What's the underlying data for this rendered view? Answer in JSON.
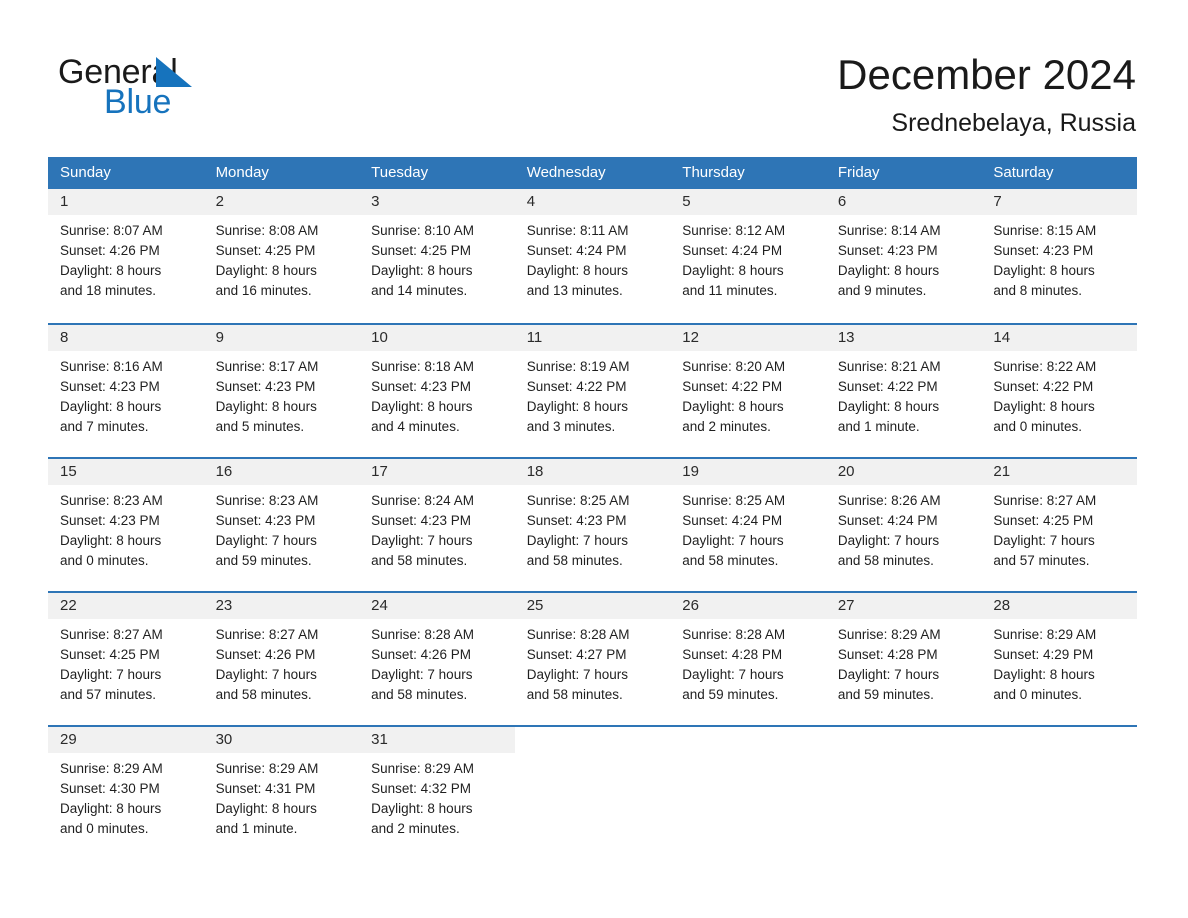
{
  "brand": {
    "name_part1": "General",
    "name_part2": "Blue",
    "accent_color": "#1673bd"
  },
  "header": {
    "month_title": "December 2024",
    "location": "Srednebelaya, Russia"
  },
  "calendar": {
    "header_color": "#2e75b6",
    "band_color": "#f1f1f1",
    "weekdays": [
      "Sunday",
      "Monday",
      "Tuesday",
      "Wednesday",
      "Thursday",
      "Friday",
      "Saturday"
    ],
    "weeks": [
      [
        {
          "day": "1",
          "sunrise": "Sunrise: 8:07 AM",
          "sunset": "Sunset: 4:26 PM",
          "daylight_line1": "Daylight: 8 hours",
          "daylight_line2": "and 18 minutes."
        },
        {
          "day": "2",
          "sunrise": "Sunrise: 8:08 AM",
          "sunset": "Sunset: 4:25 PM",
          "daylight_line1": "Daylight: 8 hours",
          "daylight_line2": "and 16 minutes."
        },
        {
          "day": "3",
          "sunrise": "Sunrise: 8:10 AM",
          "sunset": "Sunset: 4:25 PM",
          "daylight_line1": "Daylight: 8 hours",
          "daylight_line2": "and 14 minutes."
        },
        {
          "day": "4",
          "sunrise": "Sunrise: 8:11 AM",
          "sunset": "Sunset: 4:24 PM",
          "daylight_line1": "Daylight: 8 hours",
          "daylight_line2": "and 13 minutes."
        },
        {
          "day": "5",
          "sunrise": "Sunrise: 8:12 AM",
          "sunset": "Sunset: 4:24 PM",
          "daylight_line1": "Daylight: 8 hours",
          "daylight_line2": "and 11 minutes."
        },
        {
          "day": "6",
          "sunrise": "Sunrise: 8:14 AM",
          "sunset": "Sunset: 4:23 PM",
          "daylight_line1": "Daylight: 8 hours",
          "daylight_line2": "and 9 minutes."
        },
        {
          "day": "7",
          "sunrise": "Sunrise: 8:15 AM",
          "sunset": "Sunset: 4:23 PM",
          "daylight_line1": "Daylight: 8 hours",
          "daylight_line2": "and 8 minutes."
        }
      ],
      [
        {
          "day": "8",
          "sunrise": "Sunrise: 8:16 AM",
          "sunset": "Sunset: 4:23 PM",
          "daylight_line1": "Daylight: 8 hours",
          "daylight_line2": "and 7 minutes."
        },
        {
          "day": "9",
          "sunrise": "Sunrise: 8:17 AM",
          "sunset": "Sunset: 4:23 PM",
          "daylight_line1": "Daylight: 8 hours",
          "daylight_line2": "and 5 minutes."
        },
        {
          "day": "10",
          "sunrise": "Sunrise: 8:18 AM",
          "sunset": "Sunset: 4:23 PM",
          "daylight_line1": "Daylight: 8 hours",
          "daylight_line2": "and 4 minutes."
        },
        {
          "day": "11",
          "sunrise": "Sunrise: 8:19 AM",
          "sunset": "Sunset: 4:22 PM",
          "daylight_line1": "Daylight: 8 hours",
          "daylight_line2": "and 3 minutes."
        },
        {
          "day": "12",
          "sunrise": "Sunrise: 8:20 AM",
          "sunset": "Sunset: 4:22 PM",
          "daylight_line1": "Daylight: 8 hours",
          "daylight_line2": "and 2 minutes."
        },
        {
          "day": "13",
          "sunrise": "Sunrise: 8:21 AM",
          "sunset": "Sunset: 4:22 PM",
          "daylight_line1": "Daylight: 8 hours",
          "daylight_line2": "and 1 minute."
        },
        {
          "day": "14",
          "sunrise": "Sunrise: 8:22 AM",
          "sunset": "Sunset: 4:22 PM",
          "daylight_line1": "Daylight: 8 hours",
          "daylight_line2": "and 0 minutes."
        }
      ],
      [
        {
          "day": "15",
          "sunrise": "Sunrise: 8:23 AM",
          "sunset": "Sunset: 4:23 PM",
          "daylight_line1": "Daylight: 8 hours",
          "daylight_line2": "and 0 minutes."
        },
        {
          "day": "16",
          "sunrise": "Sunrise: 8:23 AM",
          "sunset": "Sunset: 4:23 PM",
          "daylight_line1": "Daylight: 7 hours",
          "daylight_line2": "and 59 minutes."
        },
        {
          "day": "17",
          "sunrise": "Sunrise: 8:24 AM",
          "sunset": "Sunset: 4:23 PM",
          "daylight_line1": "Daylight: 7 hours",
          "daylight_line2": "and 58 minutes."
        },
        {
          "day": "18",
          "sunrise": "Sunrise: 8:25 AM",
          "sunset": "Sunset: 4:23 PM",
          "daylight_line1": "Daylight: 7 hours",
          "daylight_line2": "and 58 minutes."
        },
        {
          "day": "19",
          "sunrise": "Sunrise: 8:25 AM",
          "sunset": "Sunset: 4:24 PM",
          "daylight_line1": "Daylight: 7 hours",
          "daylight_line2": "and 58 minutes."
        },
        {
          "day": "20",
          "sunrise": "Sunrise: 8:26 AM",
          "sunset": "Sunset: 4:24 PM",
          "daylight_line1": "Daylight: 7 hours",
          "daylight_line2": "and 58 minutes."
        },
        {
          "day": "21",
          "sunrise": "Sunrise: 8:27 AM",
          "sunset": "Sunset: 4:25 PM",
          "daylight_line1": "Daylight: 7 hours",
          "daylight_line2": "and 57 minutes."
        }
      ],
      [
        {
          "day": "22",
          "sunrise": "Sunrise: 8:27 AM",
          "sunset": "Sunset: 4:25 PM",
          "daylight_line1": "Daylight: 7 hours",
          "daylight_line2": "and 57 minutes."
        },
        {
          "day": "23",
          "sunrise": "Sunrise: 8:27 AM",
          "sunset": "Sunset: 4:26 PM",
          "daylight_line1": "Daylight: 7 hours",
          "daylight_line2": "and 58 minutes."
        },
        {
          "day": "24",
          "sunrise": "Sunrise: 8:28 AM",
          "sunset": "Sunset: 4:26 PM",
          "daylight_line1": "Daylight: 7 hours",
          "daylight_line2": "and 58 minutes."
        },
        {
          "day": "25",
          "sunrise": "Sunrise: 8:28 AM",
          "sunset": "Sunset: 4:27 PM",
          "daylight_line1": "Daylight: 7 hours",
          "daylight_line2": "and 58 minutes."
        },
        {
          "day": "26",
          "sunrise": "Sunrise: 8:28 AM",
          "sunset": "Sunset: 4:28 PM",
          "daylight_line1": "Daylight: 7 hours",
          "daylight_line2": "and 59 minutes."
        },
        {
          "day": "27",
          "sunrise": "Sunrise: 8:29 AM",
          "sunset": "Sunset: 4:28 PM",
          "daylight_line1": "Daylight: 7 hours",
          "daylight_line2": "and 59 minutes."
        },
        {
          "day": "28",
          "sunrise": "Sunrise: 8:29 AM",
          "sunset": "Sunset: 4:29 PM",
          "daylight_line1": "Daylight: 8 hours",
          "daylight_line2": "and 0 minutes."
        }
      ],
      [
        {
          "day": "29",
          "sunrise": "Sunrise: 8:29 AM",
          "sunset": "Sunset: 4:30 PM",
          "daylight_line1": "Daylight: 8 hours",
          "daylight_line2": "and 0 minutes."
        },
        {
          "day": "30",
          "sunrise": "Sunrise: 8:29 AM",
          "sunset": "Sunset: 4:31 PM",
          "daylight_line1": "Daylight: 8 hours",
          "daylight_line2": "and 1 minute."
        },
        {
          "day": "31",
          "sunrise": "Sunrise: 8:29 AM",
          "sunset": "Sunset: 4:32 PM",
          "daylight_line1": "Daylight: 8 hours",
          "daylight_line2": "and 2 minutes."
        },
        {
          "day": "",
          "sunrise": "",
          "sunset": "",
          "daylight_line1": "",
          "daylight_line2": ""
        },
        {
          "day": "",
          "sunrise": "",
          "sunset": "",
          "daylight_line1": "",
          "daylight_line2": ""
        },
        {
          "day": "",
          "sunrise": "",
          "sunset": "",
          "daylight_line1": "",
          "daylight_line2": ""
        },
        {
          "day": "",
          "sunrise": "",
          "sunset": "",
          "daylight_line1": "",
          "daylight_line2": ""
        }
      ]
    ]
  }
}
